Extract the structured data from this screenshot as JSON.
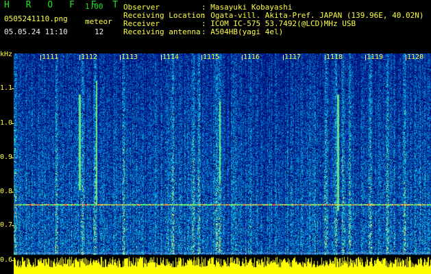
{
  "header": {
    "app_title": "H R O F F T",
    "app_version": "1.00",
    "filename": "0505241110.png",
    "mode_label": "meteor",
    "datetime": "05.05.24 11:10",
    "meteor_count": "12",
    "fields": [
      {
        "label": "Observer",
        "value": ": Masayuki Kobayashi"
      },
      {
        "label": "Receiving Location",
        "value": ": Ogata-vill. Akita-Pref. JAPAN (139.96E, 40.02N)"
      },
      {
        "label": "Receiver",
        "value": ": ICOM IC-575 53.7492(@LCD)MHz USB"
      },
      {
        "label": "Receiving antenna",
        "value": ": A504HB(yagi 4el)"
      }
    ]
  },
  "axes": {
    "y_unit": "kHz",
    "y_ticks": [
      "1.1",
      "1.0",
      "0.9",
      "0.8",
      "0.7",
      "0.6"
    ],
    "x_ticks": [
      "1111",
      "1112",
      "1113",
      "1114",
      "1115",
      "1116",
      "1117",
      "1118",
      "1119",
      "1120"
    ]
  },
  "colors": {
    "background": "#000000",
    "label_yellow": "#ffff40",
    "label_green": "#22e022",
    "label_white": "#f0f0f0",
    "spectrogram_base": "#0a1c8c",
    "carrier_line": "#ff4050",
    "noise_bar": "#ffff00"
  }
}
